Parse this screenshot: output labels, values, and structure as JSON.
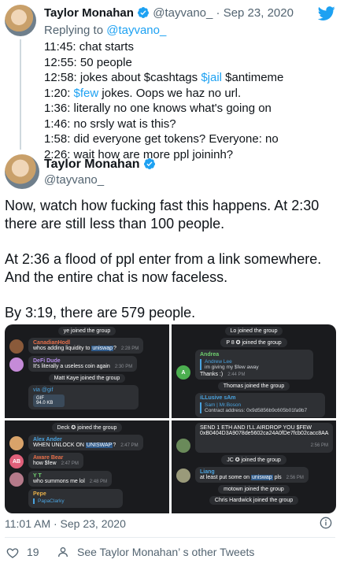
{
  "reply_tweet": {
    "author_name": "Taylor Monahan",
    "handle": "@tayvano_",
    "date": "Sep 23, 2020",
    "separator": "·",
    "replying_to_prefix": "Replying to ",
    "replying_to_handle": "@tayvano_",
    "lines": [
      {
        "time": "11:45:",
        "text": " chat starts"
      },
      {
        "time": "12:55:",
        "text": " 50 people"
      },
      {
        "time": "12:58:",
        "pre": " jokes about $cashtags ",
        "tag": "$jail",
        "post": " $antimeme"
      },
      {
        "time": "1:20:",
        "pre": " ",
        "tag": "$few",
        "post": " jokes. Oops we haz no url."
      },
      {
        "time": "1:36:",
        "text": " literally no one knows what's going on"
      },
      {
        "time": "1:46:",
        "text": " no srsly wat is this?"
      },
      {
        "time": "1:58:",
        "text": " did everyone get tokens? Everyone: no"
      },
      {
        "time": "2:26:",
        "text": " wait how are more ppl joininh?"
      }
    ]
  },
  "main_tweet": {
    "author_name": "Taylor Monahan",
    "handle": "@tayvano_",
    "paragraphs": [
      "Now, watch how fucking fast this happens. At 2:30 there are still less than 100 people.",
      "At 2:36 a flood of ppl enter from a link somewhere. And the entire chat is now faceless.",
      "By 3:19, there are 579 people."
    ],
    "timestamp": "11:01 AM · Sep 23, 2020",
    "likes": "19",
    "other_tweets_label": "See Taylor Monahan’ s other Tweets"
  },
  "screenshots": {
    "top_left": {
      "joined_1": "ye joined the group",
      "m1_name": "CanadianHodl",
      "m1_pre": "whos adding liquidity to ",
      "m1_hl": "uniswap",
      "m1_post": "?",
      "m1_time": "2:28 PM",
      "m2_name": "DeFi Dude",
      "m2_text": "It's literally a useless coin again",
      "m2_time": "2:30 PM",
      "joined_2": "Matt Kaye joined the group",
      "m3_text": "via @gif",
      "m3_gif": "GIF",
      "m3_size": "94.0 KB"
    },
    "top_right": {
      "joined_1": "Lo joined the group",
      "joined_2": "P 8 ✪ joined the group",
      "m1_name": "Andrea",
      "m1_reply_name": "Andrew Lee",
      "m1_reply_text": "im giving my $few away",
      "m1_text": "Thanks :)",
      "m1_time": "2:44 PM",
      "m1_avatar": "A",
      "joined_3": "Thomas joined the group",
      "m2_name": "iLLusive sAm",
      "m2_reply_name": "Sam | Mr.Boson",
      "m2_reply_text": "Contract address: 0x9d5856b9c605b01fa9b7"
    },
    "bottom_left": {
      "joined_1": "Deck ✪ joined the group",
      "m1_name": "Alex Ander",
      "m1_pre": "WHEN UNLOCK ON ",
      "m1_hl": "UNISWAP",
      "m1_post": "?",
      "m1_time": "2:47 PM",
      "m2_name": "Aware Bear",
      "m2_text": "how $few",
      "m2_time": "2:47 PM",
      "m2_avatar": "AB",
      "m3_name": "Y T",
      "m3_text": "who summons me lol",
      "m3_time": "2:48 PM",
      "m4_name": "Pepe",
      "m4_reply_name": "PapaClarky"
    },
    "bottom_right": {
      "m1_text": "SEND 1 ETH AND I'LL AIRDROP YOU $FEW 0xB0404D3A9078de5602ca24A0fDe7fcb02cacc8AA",
      "m1_time": "2:56 PM",
      "joined_1": "JC ✪ joined the group",
      "m2_name": "Liang",
      "m2_pre": "at least put some on ",
      "m2_hl": "uniswap",
      "m2_post": " pls",
      "m2_time": "2:56 PM",
      "joined_2": "motown joined the group",
      "joined_3": "Chris Hardwick joined the group"
    }
  },
  "colors": {
    "twitter_blue": "#1da1f2",
    "telegram_dark": "#1a1b1e",
    "bubble": "#2e3034"
  }
}
